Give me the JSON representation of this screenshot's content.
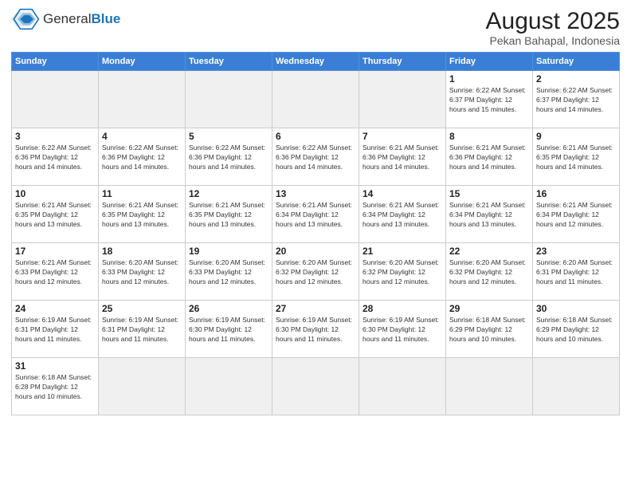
{
  "header": {
    "logo_general": "General",
    "logo_blue": "Blue",
    "title": "August 2025",
    "subtitle": "Pekan Bahapal, Indonesia"
  },
  "weekdays": [
    "Sunday",
    "Monday",
    "Tuesday",
    "Wednesday",
    "Thursday",
    "Friday",
    "Saturday"
  ],
  "weeks": [
    [
      {
        "day": "",
        "info": "",
        "empty": true
      },
      {
        "day": "",
        "info": "",
        "empty": true
      },
      {
        "day": "",
        "info": "",
        "empty": true
      },
      {
        "day": "",
        "info": "",
        "empty": true
      },
      {
        "day": "",
        "info": "",
        "empty": true
      },
      {
        "day": "1",
        "info": "Sunrise: 6:22 AM\nSunset: 6:37 PM\nDaylight: 12 hours\nand 15 minutes."
      },
      {
        "day": "2",
        "info": "Sunrise: 6:22 AM\nSunset: 6:37 PM\nDaylight: 12 hours\nand 14 minutes."
      }
    ],
    [
      {
        "day": "3",
        "info": "Sunrise: 6:22 AM\nSunset: 6:36 PM\nDaylight: 12 hours\nand 14 minutes."
      },
      {
        "day": "4",
        "info": "Sunrise: 6:22 AM\nSunset: 6:36 PM\nDaylight: 12 hours\nand 14 minutes."
      },
      {
        "day": "5",
        "info": "Sunrise: 6:22 AM\nSunset: 6:36 PM\nDaylight: 12 hours\nand 14 minutes."
      },
      {
        "day": "6",
        "info": "Sunrise: 6:22 AM\nSunset: 6:36 PM\nDaylight: 12 hours\nand 14 minutes."
      },
      {
        "day": "7",
        "info": "Sunrise: 6:21 AM\nSunset: 6:36 PM\nDaylight: 12 hours\nand 14 minutes."
      },
      {
        "day": "8",
        "info": "Sunrise: 6:21 AM\nSunset: 6:36 PM\nDaylight: 12 hours\nand 14 minutes."
      },
      {
        "day": "9",
        "info": "Sunrise: 6:21 AM\nSunset: 6:35 PM\nDaylight: 12 hours\nand 14 minutes."
      }
    ],
    [
      {
        "day": "10",
        "info": "Sunrise: 6:21 AM\nSunset: 6:35 PM\nDaylight: 12 hours\nand 13 minutes."
      },
      {
        "day": "11",
        "info": "Sunrise: 6:21 AM\nSunset: 6:35 PM\nDaylight: 12 hours\nand 13 minutes."
      },
      {
        "day": "12",
        "info": "Sunrise: 6:21 AM\nSunset: 6:35 PM\nDaylight: 12 hours\nand 13 minutes."
      },
      {
        "day": "13",
        "info": "Sunrise: 6:21 AM\nSunset: 6:34 PM\nDaylight: 12 hours\nand 13 minutes."
      },
      {
        "day": "14",
        "info": "Sunrise: 6:21 AM\nSunset: 6:34 PM\nDaylight: 12 hours\nand 13 minutes."
      },
      {
        "day": "15",
        "info": "Sunrise: 6:21 AM\nSunset: 6:34 PM\nDaylight: 12 hours\nand 13 minutes."
      },
      {
        "day": "16",
        "info": "Sunrise: 6:21 AM\nSunset: 6:34 PM\nDaylight: 12 hours\nand 12 minutes."
      }
    ],
    [
      {
        "day": "17",
        "info": "Sunrise: 6:21 AM\nSunset: 6:33 PM\nDaylight: 12 hours\nand 12 minutes."
      },
      {
        "day": "18",
        "info": "Sunrise: 6:20 AM\nSunset: 6:33 PM\nDaylight: 12 hours\nand 12 minutes."
      },
      {
        "day": "19",
        "info": "Sunrise: 6:20 AM\nSunset: 6:33 PM\nDaylight: 12 hours\nand 12 minutes."
      },
      {
        "day": "20",
        "info": "Sunrise: 6:20 AM\nSunset: 6:32 PM\nDaylight: 12 hours\nand 12 minutes."
      },
      {
        "day": "21",
        "info": "Sunrise: 6:20 AM\nSunset: 6:32 PM\nDaylight: 12 hours\nand 12 minutes."
      },
      {
        "day": "22",
        "info": "Sunrise: 6:20 AM\nSunset: 6:32 PM\nDaylight: 12 hours\nand 12 minutes."
      },
      {
        "day": "23",
        "info": "Sunrise: 6:20 AM\nSunset: 6:31 PM\nDaylight: 12 hours\nand 11 minutes."
      }
    ],
    [
      {
        "day": "24",
        "info": "Sunrise: 6:19 AM\nSunset: 6:31 PM\nDaylight: 12 hours\nand 11 minutes."
      },
      {
        "day": "25",
        "info": "Sunrise: 6:19 AM\nSunset: 6:31 PM\nDaylight: 12 hours\nand 11 minutes."
      },
      {
        "day": "26",
        "info": "Sunrise: 6:19 AM\nSunset: 6:30 PM\nDaylight: 12 hours\nand 11 minutes."
      },
      {
        "day": "27",
        "info": "Sunrise: 6:19 AM\nSunset: 6:30 PM\nDaylight: 12 hours\nand 11 minutes."
      },
      {
        "day": "28",
        "info": "Sunrise: 6:19 AM\nSunset: 6:30 PM\nDaylight: 12 hours\nand 11 minutes."
      },
      {
        "day": "29",
        "info": "Sunrise: 6:18 AM\nSunset: 6:29 PM\nDaylight: 12 hours\nand 10 minutes."
      },
      {
        "day": "30",
        "info": "Sunrise: 6:18 AM\nSunset: 6:29 PM\nDaylight: 12 hours\nand 10 minutes."
      }
    ],
    [
      {
        "day": "31",
        "info": "Sunrise: 6:18 AM\nSunset: 6:28 PM\nDaylight: 12 hours\nand 10 minutes."
      },
      {
        "day": "",
        "info": "",
        "empty": true
      },
      {
        "day": "",
        "info": "",
        "empty": true
      },
      {
        "day": "",
        "info": "",
        "empty": true
      },
      {
        "day": "",
        "info": "",
        "empty": true
      },
      {
        "day": "",
        "info": "",
        "empty": true
      },
      {
        "day": "",
        "info": "",
        "empty": true
      }
    ]
  ]
}
